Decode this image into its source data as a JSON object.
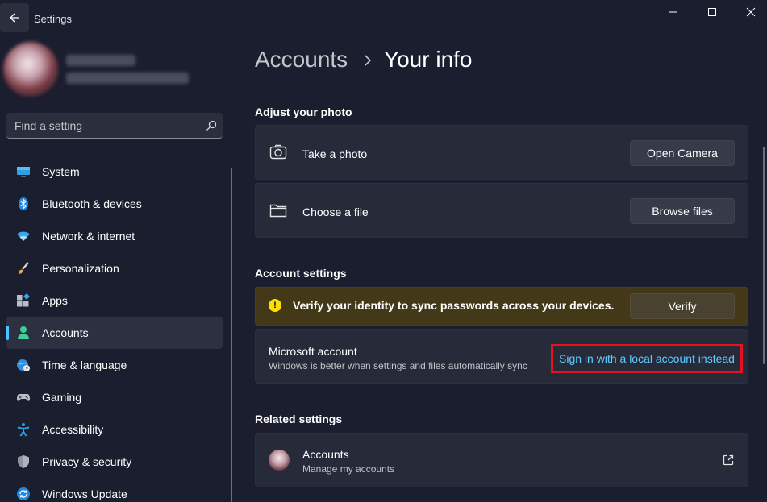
{
  "window": {
    "title": "Settings"
  },
  "search": {
    "placeholder": "Find a setting"
  },
  "sidebar": {
    "items": [
      {
        "label": "System",
        "icon": "monitor-icon"
      },
      {
        "label": "Bluetooth & devices",
        "icon": "bluetooth-icon"
      },
      {
        "label": "Network & internet",
        "icon": "wifi-icon"
      },
      {
        "label": "Personalization",
        "icon": "brush-icon"
      },
      {
        "label": "Apps",
        "icon": "apps-icon"
      },
      {
        "label": "Accounts",
        "icon": "person-icon",
        "active": true
      },
      {
        "label": "Time & language",
        "icon": "globe-clock-icon"
      },
      {
        "label": "Gaming",
        "icon": "gamepad-icon"
      },
      {
        "label": "Accessibility",
        "icon": "accessibility-icon"
      },
      {
        "label": "Privacy & security",
        "icon": "shield-icon"
      },
      {
        "label": "Windows Update",
        "icon": "update-icon"
      }
    ]
  },
  "breadcrumb": {
    "parent": "Accounts",
    "current": "Your info"
  },
  "adjust_photo": {
    "title": "Adjust your photo",
    "take_photo": {
      "label": "Take a photo",
      "button": "Open Camera"
    },
    "choose_file": {
      "label": "Choose a file",
      "button": "Browse files"
    }
  },
  "account_settings": {
    "title": "Account settings",
    "warning": {
      "text": "Verify your identity to sync passwords across your devices.",
      "button": "Verify",
      "icon_glyph": "!"
    },
    "microsoft_account": {
      "label": "Microsoft account",
      "description": "Windows is better when settings and files automatically sync",
      "link": "Sign in with a local account instead"
    }
  },
  "related_settings": {
    "title": "Related settings",
    "accounts": {
      "label": "Accounts",
      "description": "Manage my accounts"
    }
  },
  "colors": {
    "background": "#1b1e2e",
    "accent": "#4cc2ff",
    "link": "#60cdff",
    "highlight_border": "#e81123",
    "warning": "#fce100"
  }
}
